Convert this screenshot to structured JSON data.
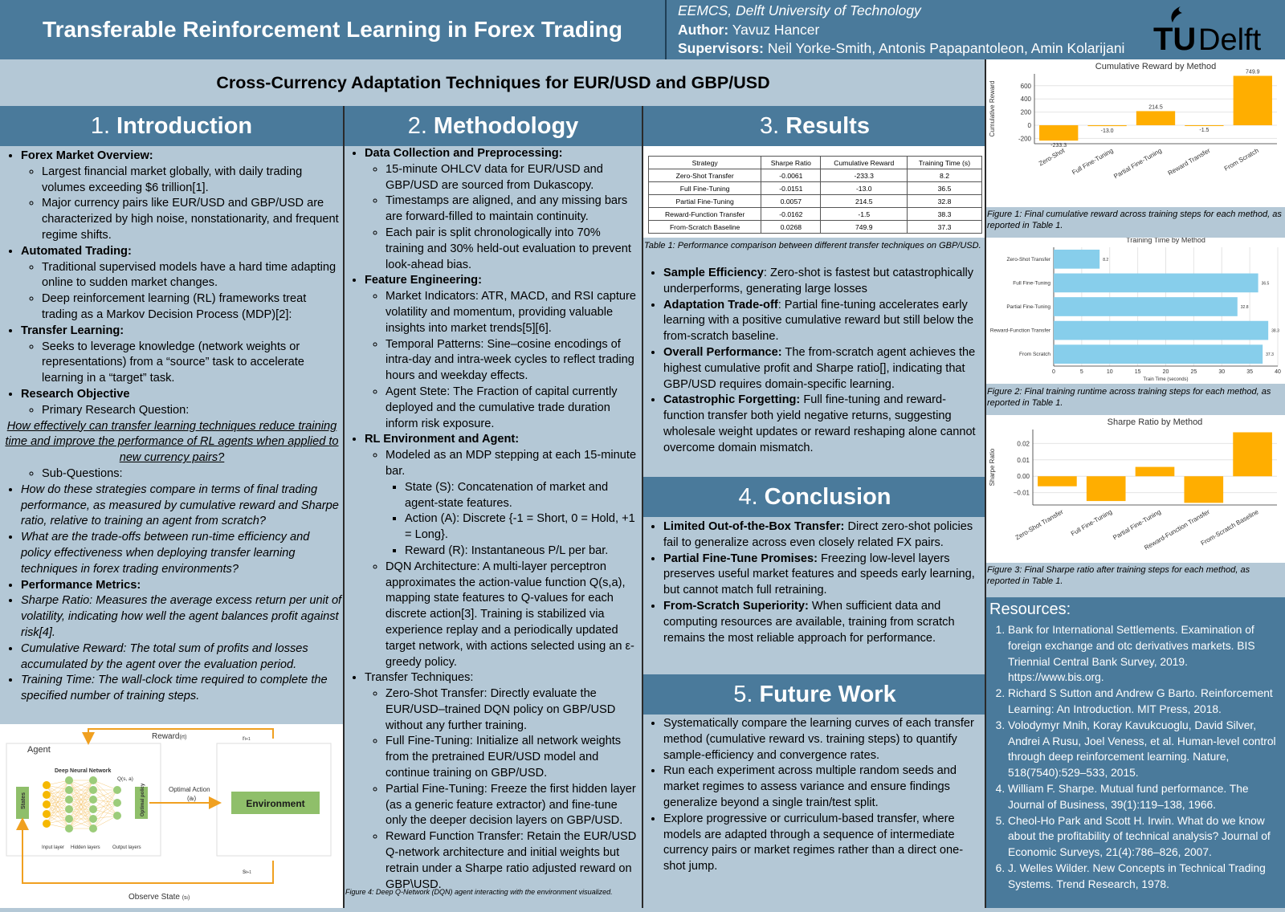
{
  "header": {
    "title": "Transferable Reinforcement Learning in Forex Trading",
    "affiliation": "EEMCS, Delft University of Technology",
    "author_label": "Author:",
    "author": "Yavuz Hancer",
    "supervisors_label": "Supervisors:",
    "supervisors": "Neil Yorke-Smith, Antonis Papapantoleon, Amin Kolarijani",
    "logo_text": "TUDelft"
  },
  "subtitle": "Cross-Currency Adaptation Techniques for EUR/USD and GBP/USD",
  "intro": {
    "num": "1.",
    "heading": "Introduction",
    "b1": "Forex Market Overview:",
    "b1a": "Largest financial market globally, with daily trading volumes exceeding $6 trillion[1].",
    "b1b": "Major currency pairs like EUR/USD and GBP/USD are characterized by high noise, nonstationarity, and frequent regime shifts.",
    "b2": "Automated Trading:",
    "b2a": "Traditional supervised models have a hard time adapting online to sudden market changes.",
    "b2b": "Deep reinforcement learning (RL) frameworks treat trading as a Markov Decision Process (MDP)[2]:",
    "b3": "Transfer Learning:",
    "b3a": "Seeks to leverage knowledge (network weights or representations) from a “source” task to accelerate learning in a “target” task.",
    "b4": "Research Objective",
    "b4a": "Primary Research Question:",
    "rq": "How effectively can transfer learning techniques reduce training time and improve the performance of RL agents when applied to new currency pairs?",
    "b4b": "Sub-Questions:",
    "sq1": "How do these strategies compare in terms of final trading performance, as measured by cumulative reward and Sharpe ratio, relative to training an agent from scratch?",
    "sq2": "What are the trade-offs between run-time efficiency and policy effectiveness when deploying transfer learning techniques in forex trading environments?",
    "b5": "Performance Metrics:",
    "pm1": "Sharpe Ratio: Measures the average excess return per unit of volatility, indicating how well the agent balances profit against risk[4].",
    "pm2": "Cumulative Reward: The total sum of profits and losses accumulated by the agent over the evaluation period.",
    "pm3": "Training Time: The wall-clock time required to complete the specified number of training steps."
  },
  "diagram": {
    "reward": "Reward",
    "reward_sub": "(rt)",
    "r_next": "r",
    "r_next_sub": "t+1",
    "agent": "Agent",
    "dnn": "Deep Neural Network",
    "q": "Q(s, a)",
    "states": "States",
    "optimal_policy": "Optimal policy",
    "optimal_action": "Optimal Action",
    "a_t": "(a",
    "a_t_sub": "t",
    "a_t_close": ")",
    "environment": "Environment",
    "input_layer": "Input layer",
    "hidden_layers": "Hidden layers",
    "output_layers": "Output layers",
    "observe": "Observe State",
    "observe_sub": "(s",
    "observe_sub2": "t",
    "observe_close": ")",
    "s_next": "s",
    "s_next_sub": "t+1"
  },
  "method": {
    "num": "2.",
    "heading": "Methodology",
    "b1": "Data Collection and Preprocessing:",
    "b1a": "15-minute OHLCV data for EUR/USD and GBP/USD are sourced from Dukascopy.",
    "b1b": "Timestamps are aligned, and any missing bars are forward-filled to maintain continuity.",
    "b1c": "Each pair is split chronologically into 70% training and 30% held-out evaluation to prevent look-ahead bias.",
    "b2": "Feature Engineering:",
    "b2a": "Market Indicators: ATR, MACD, and RSI capture volatility and momentum, providing valuable insights into market trends[5][6].",
    "b2b": "Temporal Patterns: Sine–cosine encodings of intra-day and intra-week cycles to reflect trading hours and weekday effects.",
    "b2c": "Agent Stete: The Fraction of capital currently deployed and the cumulative trade duration inform risk exposure.",
    "b3": "RL Environment and Agent:",
    "b3a": "Modeled as an MDP stepping at each 15-minute bar.",
    "b3a1": "State (S): Concatenation of market and agent-state features.",
    "b3a2": "Action (A): Discrete {-1 = Short, 0 = Hold, +1 = Long}.",
    "b3a3": "Reward (R): Instantaneous P/L per bar.",
    "b3b": "DQN Architecture: A multi-layer perceptron approximates the action-value function Q(s,a), mapping state features to Q-values for each discrete action[3]. Training is stabilized via experience replay and a periodically updated target network, with actions selected using an ε-greedy policy.",
    "b4": "Transfer Techniques:",
    "b4a": "Zero-Shot Transfer: Directly evaluate the EUR/USD–trained DQN policy on GBP/USD without any further training.",
    "b4b": "Full Fine-Tuning: Initialize all network weights from the pretrained EUR/USD model and continue training on GBP/USD.",
    "b4c": "Partial Fine-Tuning: Freeze the first hidden layer (as a generic feature extractor) and fine-tune only the deeper decision layers on GBP/USD.",
    "b4d": "Reward Function Transfer: Retain the EUR/USD Q-network architecture and initial weights but retrain under a Sharpe ratio adjusted reward on GBP\\USD.",
    "fig4": "Figure 4: Deep Q-Network (DQN) agent interacting with the environment visualized."
  },
  "results": {
    "num": "3.",
    "heading": "Results",
    "table": {
      "headers": [
        "Strategy",
        "Sharpe Ratio",
        "Cumulative Reward",
        "Training Time (s)"
      ],
      "rows": [
        [
          "Zero-Shot Transfer",
          "-0.0061",
          "-233.3",
          "8.2"
        ],
        [
          "Full Fine-Tuning",
          "-0.0151",
          "-13.0",
          "36.5"
        ],
        [
          "Partial Fine-Tuning",
          "0.0057",
          "214.5",
          "32.8"
        ],
        [
          "Reward-Function Transfer",
          "-0.0162",
          "-1.5",
          "38.3"
        ],
        [
          "From-Scratch Baseline",
          "0.0268",
          "749.9",
          "37.3"
        ]
      ]
    },
    "table_caption": "Table 1: Performance comparison between different transfer techniques on GBP/USD.",
    "b1": "Sample Efficiency",
    "b1t": ": Zero-shot is fastest but catastrophically underperforms, generating large losses",
    "b2": "Adaptation Trade-off",
    "b2t": ": Partial fine-tuning accelerates early learning with a positive cumulative reward but still below the from-scratch baseline.",
    "b3": "Overall Performance:",
    "b3t": " The from-scratch agent achieves the highest cumulative profit and Sharpe ratio[], indicating that GBP/USD requires domain-specific learning.",
    "b4": "Catastrophic Forgetting:",
    "b4t": " Full fine-tuning and reward-function transfer both yield negative returns, suggesting wholesale weight updates or reward reshaping alone cannot overcome domain mismatch."
  },
  "conclusion": {
    "num": "4.",
    "heading": "Conclusion",
    "b1": "Limited Out-of-the-Box Transfer:",
    "b1t": " Direct zero-shot policies fail to generalize across even closely related FX pairs.",
    "b2": "Partial Fine-Tune Promises:",
    "b2t": " Freezing low-level layers preserves useful market features and speeds early learning, but cannot match full retraining.",
    "b3": "From-Scratch Superiority:",
    "b3t": " When sufficient data and computing resources are available, training from scratch remains the most reliable approach for performance."
  },
  "future": {
    "num": "5.",
    "heading": "Future Work",
    "b1": "Systematically compare the learning curves of each transfer method (cumulative reward vs. training steps) to quantify sample-efficiency and convergence rates.",
    "b2": "Run each experiment across multiple random seeds and market regimes to assess variance and ensure findings generalize beyond a single train/test split.",
    "b3": "Explore progressive or curriculum-based transfer, where models are adapted through a sequence of intermediate currency pairs or market regimes rather than a direct one-shot jump."
  },
  "chart_data": [
    {
      "type": "bar",
      "title": "Cumulative Reward by Method",
      "ylabel": "Cumulative Reward",
      "xlabel": "",
      "categories": [
        "Zero-Shot",
        "Full Fine-Tuning",
        "Partial Fine-Tuning",
        "Reward Transfer",
        "From Scratch"
      ],
      "values": [
        -233.3,
        -13.0,
        214.5,
        -1.5,
        749.9
      ],
      "labels": [
        "-233.3",
        "-13.0",
        "214.5",
        "-1.5",
        "749.9"
      ],
      "ylim": [
        -280,
        780
      ],
      "yticks": [
        -200,
        0,
        200,
        400,
        600
      ],
      "grid": true,
      "color": "#ffae00",
      "caption": "Figure 1: Final cumulative reward across training steps for each method, as reported in Table 1."
    },
    {
      "type": "bar",
      "orientation": "horizontal",
      "title": "Training Time by Method",
      "xlabel": "Train Time (seconds)",
      "ylabel": "",
      "categories": [
        "Zero-Shot Transfer",
        "Full Fine-Tuning",
        "Partial Fine-Tuning",
        "Reward-Function Transfer",
        "From Scratch"
      ],
      "values": [
        8.2,
        36.5,
        32.8,
        38.3,
        37.3
      ],
      "labels": [
        "8.2",
        "36.5",
        "32.8",
        "38.3",
        "37.3"
      ],
      "xlim": [
        0,
        40
      ],
      "xticks": [
        0,
        5,
        10,
        15,
        20,
        25,
        30,
        35,
        40
      ],
      "grid": true,
      "color": "#87ceeb",
      "caption": "Figure 2: Final training runtime across training steps for each method, as reported in Table 1."
    },
    {
      "type": "bar",
      "title": "Sharpe Ratio by Method",
      "ylabel": "Sharpe Ratio",
      "xlabel": "",
      "categories": [
        "Zero-Shot Transfer",
        "Full Fine-Tuning",
        "Partial Fine-Tuning",
        "Reward-Function Transfer",
        "From-Scratch Baseline"
      ],
      "values": [
        -0.0061,
        -0.0151,
        0.0057,
        -0.0162,
        0.0268
      ],
      "ylim": [
        -0.0175,
        0.0285
      ],
      "yticks": [
        -0.01,
        0.0,
        0.01,
        0.02
      ],
      "yticklabels": [
        "−0.01",
        "0.00",
        "0.01",
        "0.02"
      ],
      "grid": true,
      "color": "#ffae00",
      "caption": "Figure 3: Final Sharpe ratio after training steps for each method, as reported in Table 1."
    }
  ],
  "resources": {
    "heading": "Resources:",
    "items": [
      "Bank for International Settlements. Examination of foreign exchange and otc derivatives markets. BIS Triennial Central Bank Survey, 2019. https://www.bis.org.",
      "Richard S Sutton and Andrew G Barto. Reinforcement Learning: An Introduction. MIT Press, 2018.",
      "Volodymyr Mnih, Koray Kavukcuoglu, David Silver, Andrei A Rusu, Joel Veness, et al. Human-level control through deep reinforcement learning. Nature, 518(7540):529–533, 2015.",
      "William F. Sharpe. Mutual fund performance. The Journal of Business, 39(1):119–138, 1966.",
      "Cheol-Ho Park and Scott H. Irwin. What do we know about the profitability of technical analysis? Journal of Economic Surveys, 21(4):786–826, 2007.",
      "J. Welles Wilder. New Concepts in Technical Trading Systems. Trend Research, 1978."
    ]
  }
}
